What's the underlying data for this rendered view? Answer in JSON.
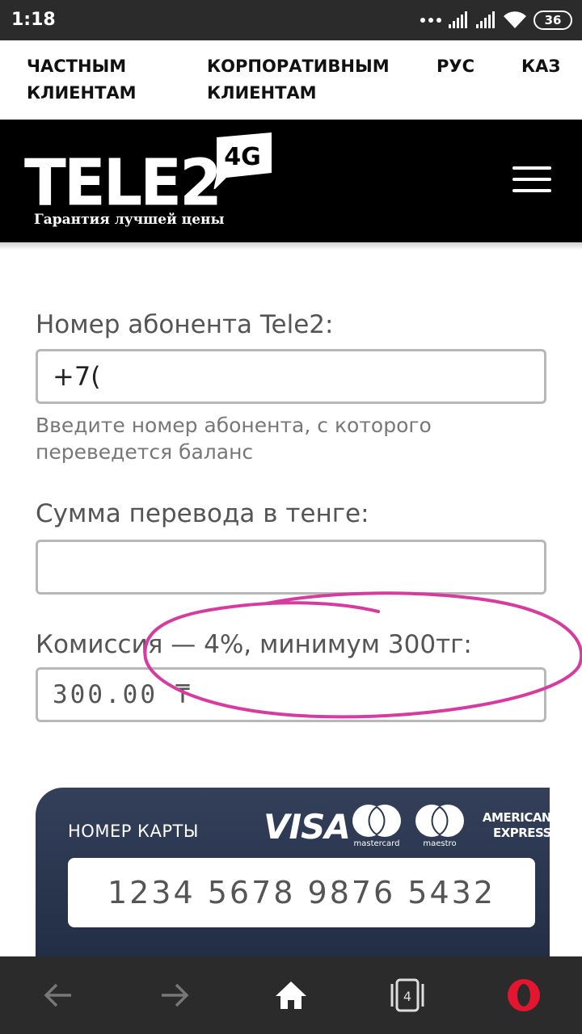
{
  "status_bar": {
    "time": "1:18",
    "battery": "36",
    "icons": [
      "dots-icon",
      "signal-icon",
      "signal-icon",
      "wifi-icon",
      "battery-icon"
    ]
  },
  "top_nav": {
    "private_line1": "ЧАСТНЫМ",
    "private_line2": "КЛИЕНТАМ",
    "corporate_line1": "КОРПОРАТИВНЫМ",
    "corporate_line2": "КЛИЕНТАМ",
    "lang_ru": "РУС",
    "lang_kz": "КАЗ"
  },
  "header": {
    "logo_text": "TELE2",
    "logo_badge": "4G",
    "tagline": "Гарантия лучшей цены",
    "menu_icon": "hamburger-icon"
  },
  "form": {
    "phone_label": "Номер абонента Tele2:",
    "phone_value": "+7(",
    "phone_hint": "Введите номер абонента, с которого переведется баланс",
    "amount_label": "Сумма перевода в тенге:",
    "amount_value": "",
    "commission_label": "Комиссия — 4%, минимум 300тг:",
    "commission_value": "300.00 ₸"
  },
  "card": {
    "number_label": "НОМЕР КАРТЫ",
    "number_placeholder": "1234 5678 9876 5432",
    "brands": {
      "visa": "VISA",
      "mastercard": "mastercard",
      "maestro": "maestro",
      "amex_line1": "AMERICAN",
      "amex_line2": "EXPRESS"
    }
  },
  "bottom_bar": {
    "tab_count": "4",
    "icons": [
      "back-icon",
      "forward-icon",
      "home-icon",
      "tabs-icon",
      "opera-icon"
    ]
  },
  "colors": {
    "header_bg": "#000000",
    "card_bg": "#2a3650",
    "annotation": "#d63ca0",
    "field_border": "#b8b8b8"
  }
}
